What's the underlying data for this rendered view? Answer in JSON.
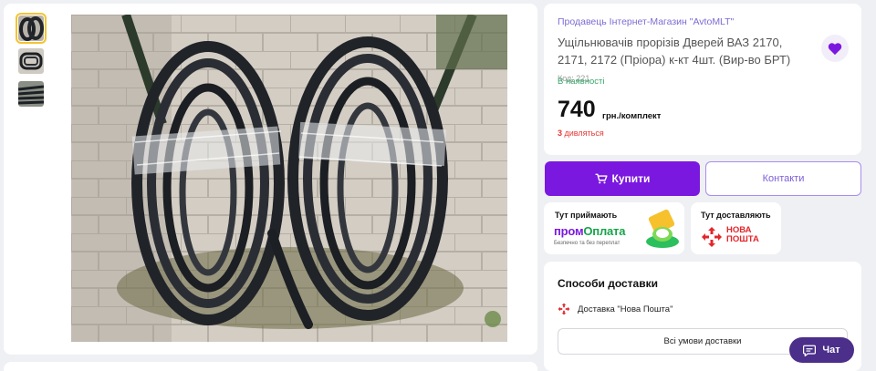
{
  "product": {
    "seller": "Продавець Інтернет-Магазин \"AvtoMLT\"",
    "title": "Ущільнювачів прорізів Дверей ВАЗ 2170, 2171, 2172 (Пріора) к-кт 4шт. (Вир-во БРТ)",
    "code": "Код: 221",
    "stock": "В наявності",
    "price": "740",
    "price_unit": "грн./комплект",
    "views_count": "3",
    "views_label": "дивляться"
  },
  "actions": {
    "buy_label": "Купити",
    "contacts_label": "Контакти",
    "chat_label": "Чат"
  },
  "payment": {
    "title": "Тут приймають",
    "brand_a": "пром",
    "brand_b": "Оплата",
    "subtitle": "Безпечно та без переплат"
  },
  "shipping": {
    "title": "Тут доставляють",
    "brand_line1": "НОВА",
    "brand_line2": "ПОШТА"
  },
  "delivery": {
    "title": "Способи доставки",
    "method": "Доставка \"Нова Пошта\"",
    "all_terms_label": "Всі умови доставки"
  },
  "colors": {
    "accent": "#7b18e0",
    "seller_link": "#7b6cd4",
    "in_stock": "#3aa66b",
    "views": "#e53935",
    "chat": "#4b2f8a",
    "nova_poshta": "#e3262b",
    "prom_green": "#16a34a"
  },
  "icons": {
    "favorite": "heart-icon",
    "buy": "cart-icon",
    "chat": "chat-icon",
    "shipping": "nova-poshta-logo-icon",
    "payment": "prom-payment-icon"
  },
  "gallery": {
    "thumbnail_count": 3,
    "active_index": 0
  }
}
